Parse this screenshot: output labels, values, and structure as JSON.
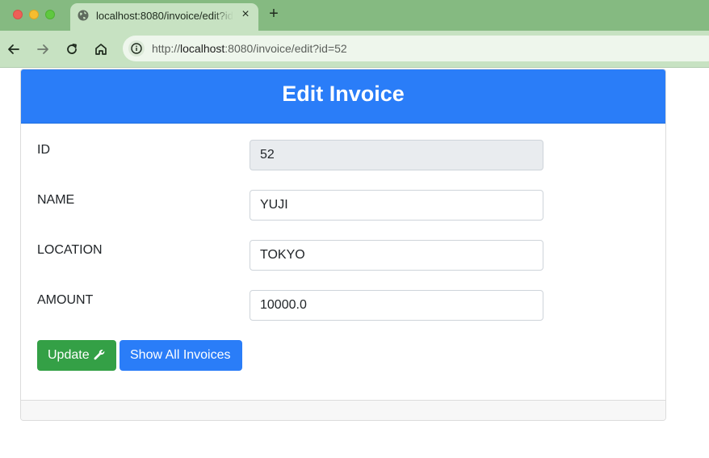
{
  "browser": {
    "tab_title": "localhost:8080/invoice/edit?id=52",
    "url_prefix": "http://",
    "url_host": "localhost",
    "url_rest": ":8080/invoice/edit?id=52",
    "new_tab_symbol": "+",
    "close_symbol": "×",
    "colors": {
      "frame": "#85ba81",
      "toolbar": "#c7e2c2"
    }
  },
  "page": {
    "title": "Edit Invoice",
    "fields": [
      {
        "label": "ID",
        "value": "52",
        "readonly": true
      },
      {
        "label": "NAME",
        "value": "YUJI",
        "readonly": false
      },
      {
        "label": "LOCATION",
        "value": "TOKYO",
        "readonly": false
      },
      {
        "label": "AMOUNT",
        "value": "10000.0",
        "readonly": false
      }
    ],
    "buttons": {
      "update_label": "Update",
      "show_all_label": "Show All Invoices"
    },
    "colors": {
      "header": "#2a7df8",
      "update": "#34a046",
      "show_all": "#2a7df8"
    }
  }
}
